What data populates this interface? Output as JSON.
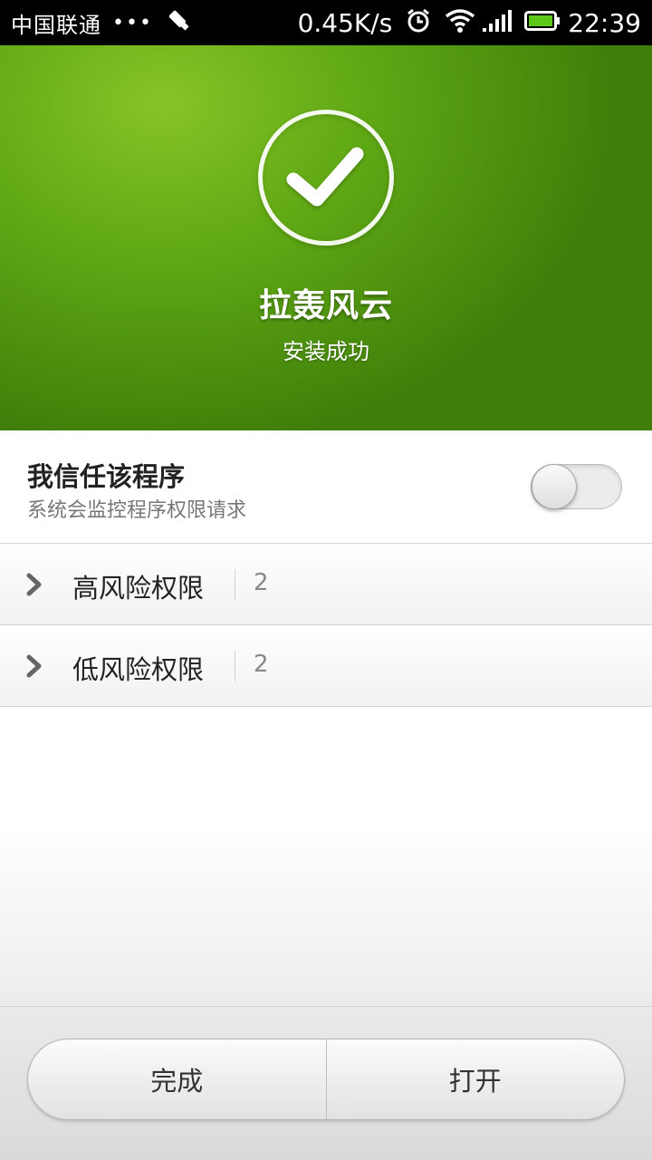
{
  "status_bar": {
    "carrier": "中国联通",
    "dots": "•••",
    "net_speed": "0.45K/s",
    "time": "22:39",
    "icons": [
      "usb-debug-icon",
      "alarm-icon",
      "wifi-icon",
      "signal-icon",
      "battery-icon"
    ]
  },
  "header": {
    "app_name": "拉轰风云",
    "status": "安装成功",
    "icon": "check-circle-icon",
    "colors": {
      "green_light": "#86c426",
      "green_dark": "#3f7e09"
    }
  },
  "trust": {
    "title": "我信任该程序",
    "subtitle": "系统会监控程序权限请求",
    "toggle_on": false
  },
  "permissions": [
    {
      "label": "高风险权限",
      "count": "2"
    },
    {
      "label": "低风险权限",
      "count": "2"
    }
  ],
  "buttons": {
    "done": "完成",
    "open": "打开"
  }
}
